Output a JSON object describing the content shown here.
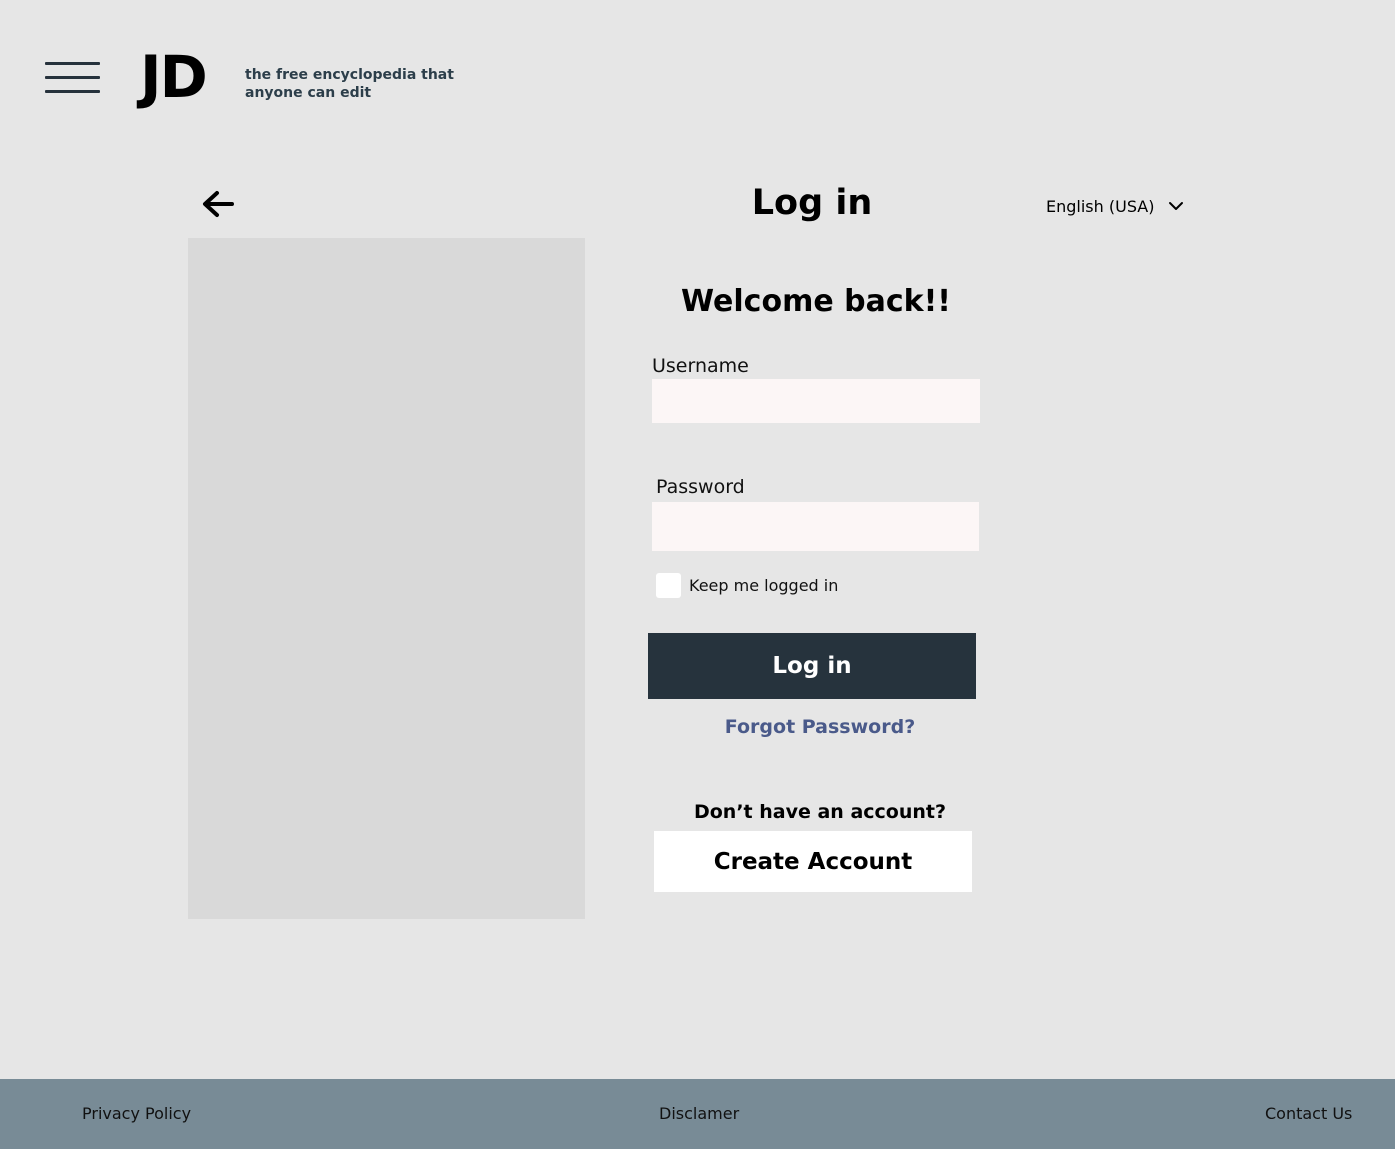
{
  "header": {
    "logo": "JD",
    "tagline_line1": "the free encyclopedia that",
    "tagline_line2": "anyone can edit"
  },
  "page": {
    "title": "Log in",
    "language": "English (USA)"
  },
  "form": {
    "welcome": "Welcome back!!",
    "username_label": "Username",
    "username_value": "",
    "password_label": "Password",
    "password_value": "",
    "keep_logged_in_label": "Keep me logged in",
    "keep_logged_in_checked": false,
    "login_button": "Log in",
    "forgot_link": "Forgot Password?",
    "no_account_text": "Don’t have an account?",
    "create_button": "Create Account"
  },
  "footer": {
    "privacy": "Privacy Policy",
    "disclaimer": "Disclamer",
    "contact": "Contact Us"
  },
  "colors": {
    "background": "#e6e6e6",
    "primary_button": "#26333d",
    "link": "#4a5a8a",
    "footer": "#788b96",
    "input_bg": "#fcf6f6"
  },
  "icons": {
    "menu": "hamburger-icon",
    "back": "arrow-left-icon",
    "dropdown": "chevron-down-icon"
  }
}
